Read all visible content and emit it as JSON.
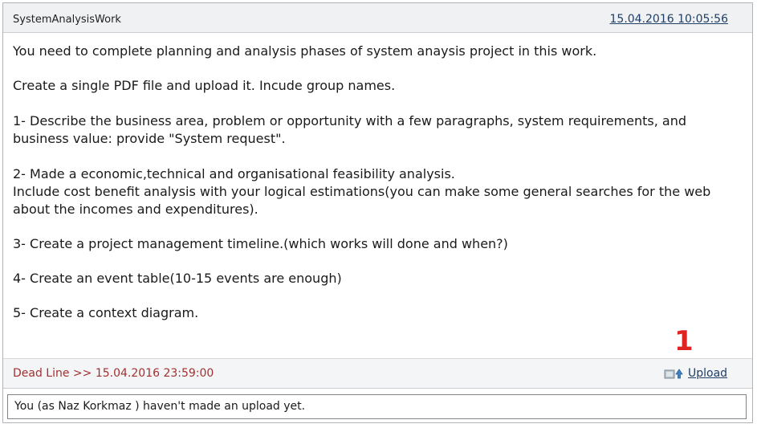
{
  "header": {
    "title": "SystemAnalysisWork",
    "date": "15.04.2016 10:05:56"
  },
  "content": {
    "paragraphs": [
      "You need to complete planning and analysis phases of system anaysis project in this work.",
      "Create a single PDF file and upload it. Incude group names.",
      "1- Describe the business area, problem or opportunity with a few paragraphs, system requirements, and",
      "business value: provide \"System request\".",
      "2- Made a economic,technical and organisational feasibility analysis.",
      "Include cost benefit analysis with your logical estimations(you can make some general searches for the web",
      "about the incomes and expenditures).",
      "3- Create a project management timeline.(which works will done and when?)",
      "4- Create an event table(10-15 events are enough)",
      "5- Create a context diagram."
    ]
  },
  "footer": {
    "deadline": "Dead Line >> 15.04.2016 23:59:00",
    "upload_label": "Upload",
    "upload_icon": "upload-arrow-icon"
  },
  "annotation": {
    "marker": "1"
  },
  "status": {
    "text": "You (as Naz Korkmaz ) haven't made an upload yet."
  }
}
